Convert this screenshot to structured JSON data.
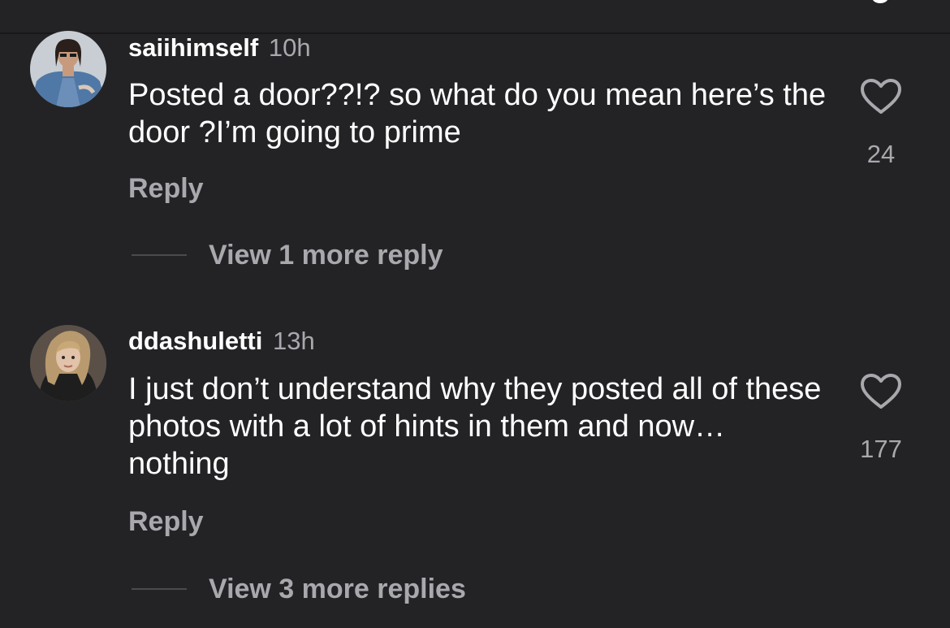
{
  "colors": {
    "background": "#232326",
    "text_primary": "#ffffff",
    "text_secondary": "#a8a8ad",
    "divider": "#4a4a4f"
  },
  "comments": [
    {
      "username": "saiihimself",
      "time": "10h",
      "text": "Posted a door??!? so what do you mean here’s the door ?I’m going to prime",
      "like_count": "24",
      "reply_label": "Reply",
      "view_replies_label": "View 1 more reply",
      "like_icon": "heart-outline-icon"
    },
    {
      "username": "ddashuletti",
      "time": "13h",
      "text": "I just don’t understand why they posted all of these photos with a lot of hints in them and now… nothing",
      "like_count": "177",
      "reply_label": "Reply",
      "view_replies_label": "View 3 more replies",
      "like_icon": "heart-outline-icon"
    }
  ]
}
